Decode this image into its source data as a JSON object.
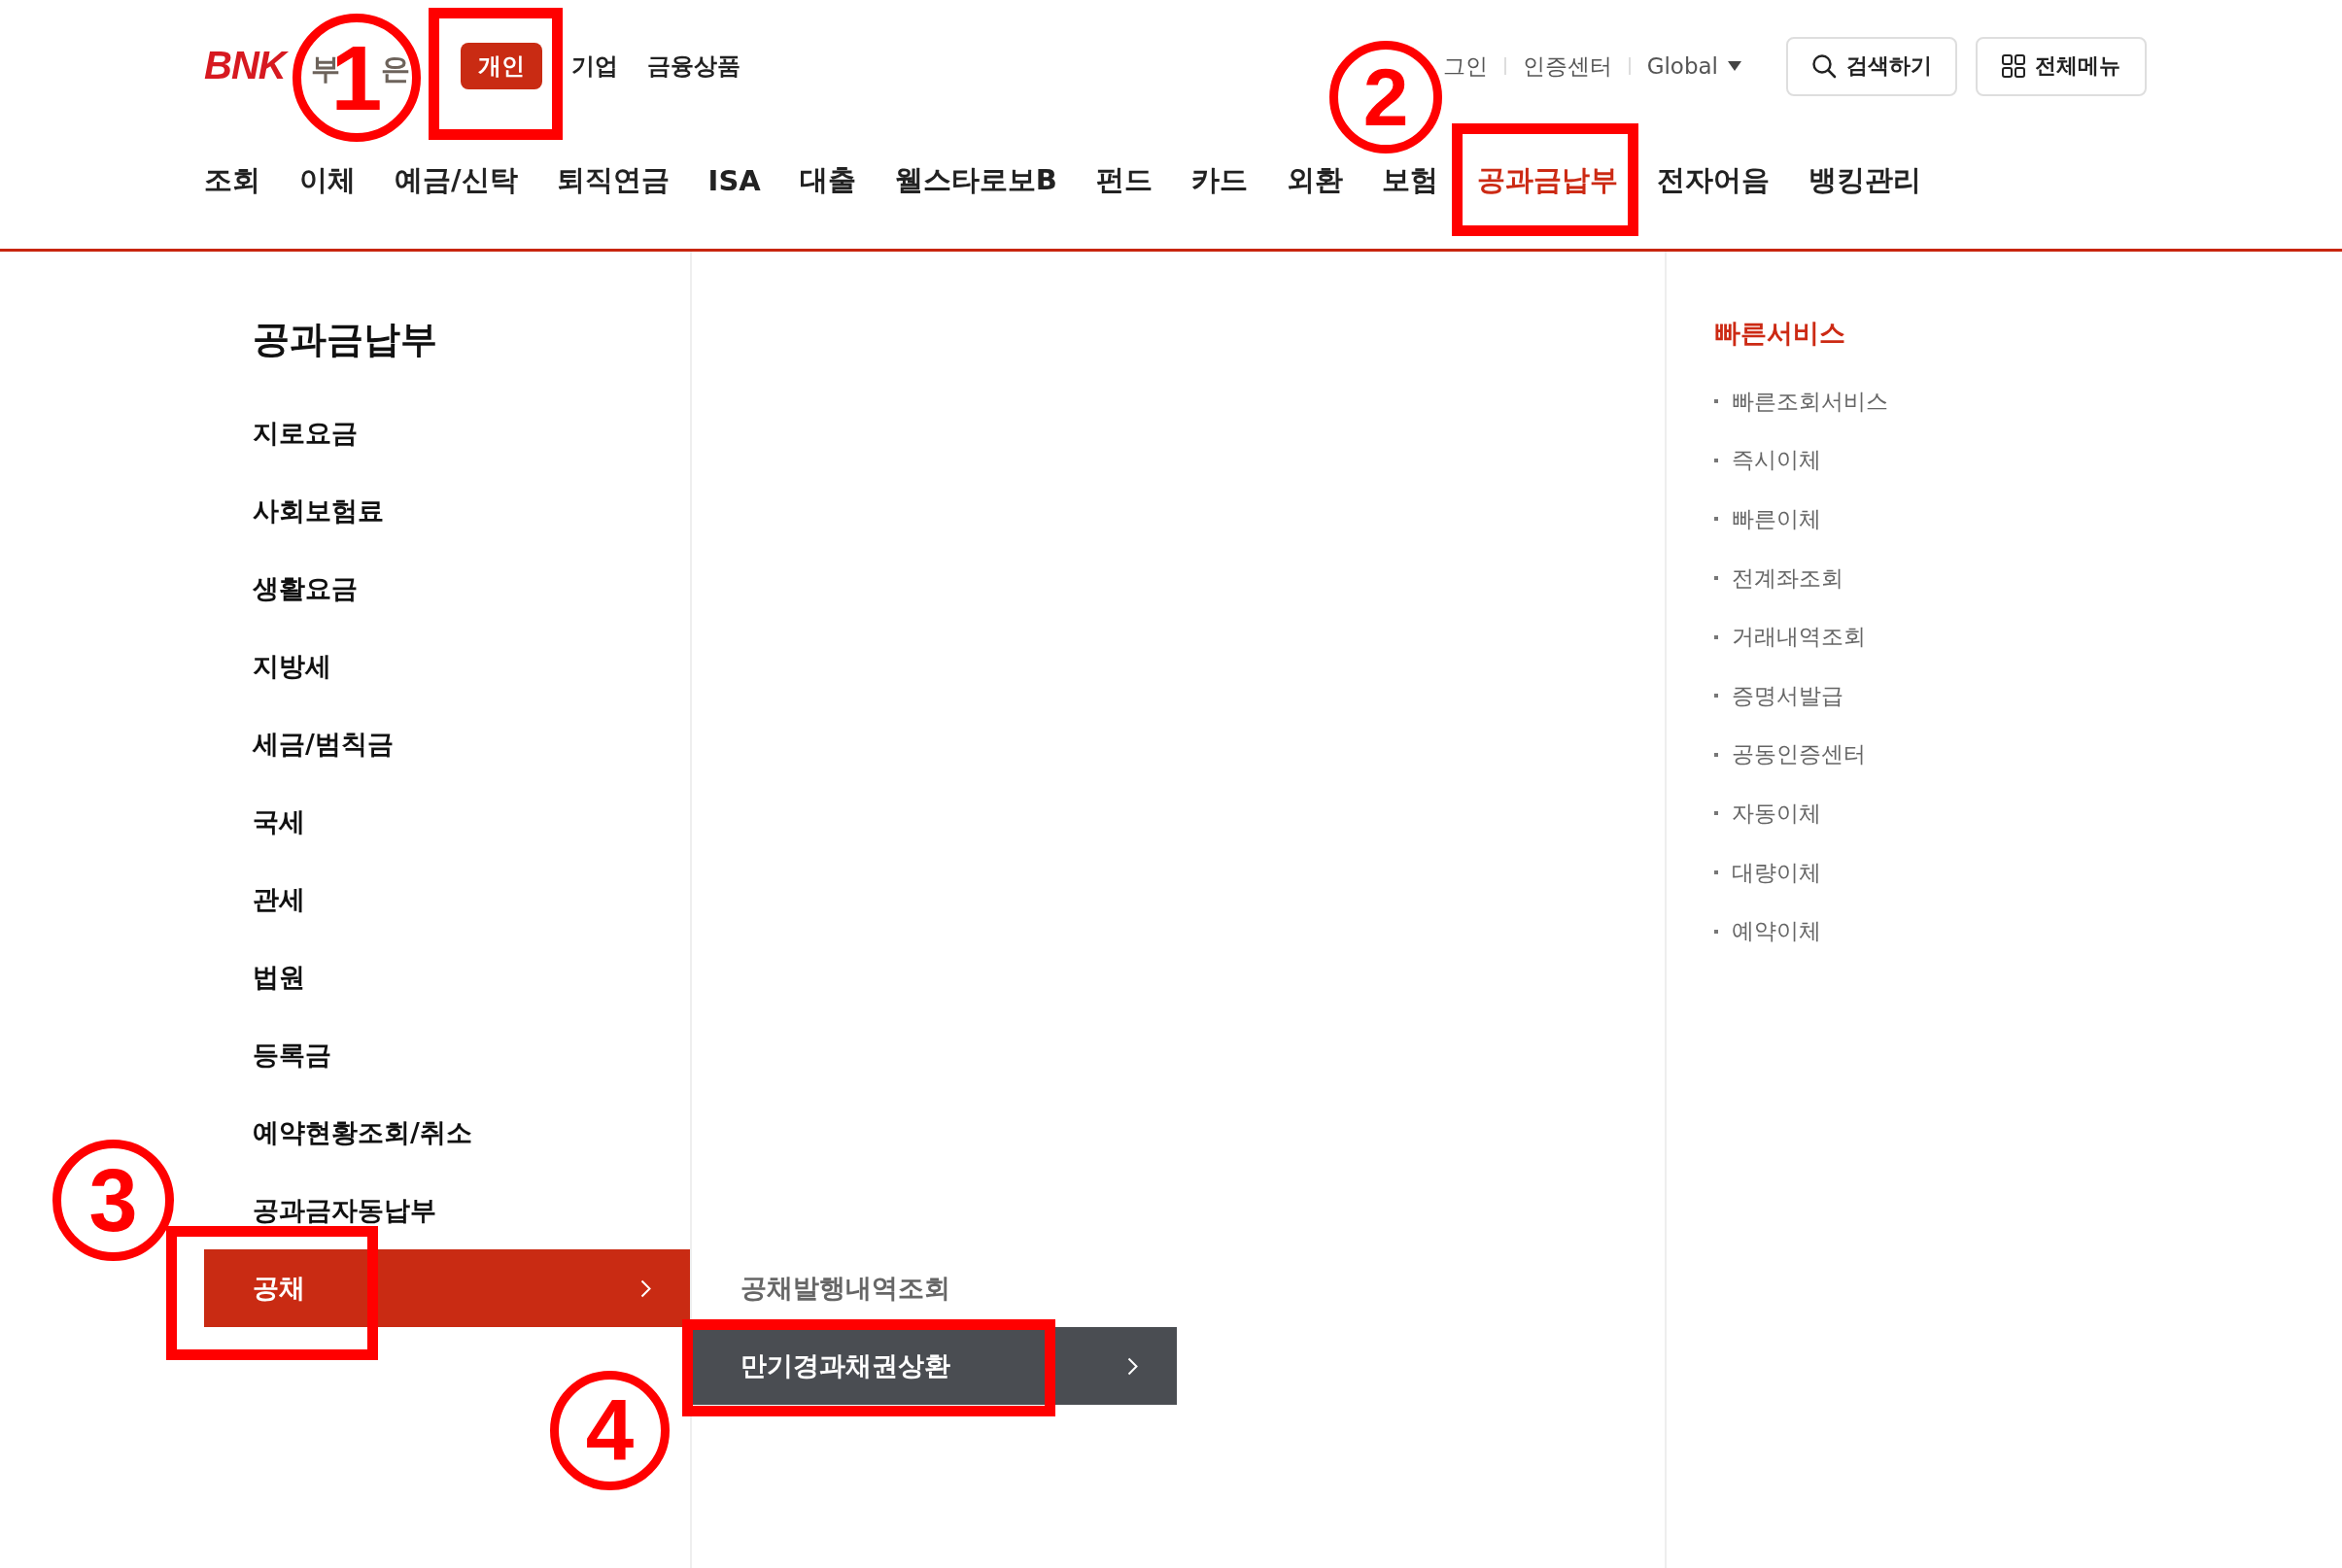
{
  "header": {
    "logo": {
      "mark": "BNK",
      "name_fragments": [
        "부",
        "은"
      ]
    },
    "segments": [
      {
        "label": "개인",
        "selected": true
      },
      {
        "label": "기업",
        "selected": false
      },
      {
        "label": "금융상품",
        "selected": false
      }
    ],
    "utility_links": [
      {
        "kind": "link",
        "label": "그인"
      },
      {
        "kind": "link",
        "label": "인증센터"
      },
      {
        "kind": "dropdown",
        "label": "Global"
      }
    ],
    "buttons": [
      {
        "kind": "search",
        "label": "검색하기"
      },
      {
        "kind": "menu",
        "label": "전체메뉴"
      }
    ]
  },
  "nav": [
    {
      "label": "조회",
      "selected": false
    },
    {
      "label": "이체",
      "selected": false
    },
    {
      "label": "예금/신탁",
      "selected": false
    },
    {
      "label": "퇴직연금",
      "selected": false
    },
    {
      "label": "ISA",
      "selected": false
    },
    {
      "label": "대출",
      "selected": false
    },
    {
      "label": "웰스타로보B",
      "selected": false
    },
    {
      "label": "펀드",
      "selected": false
    },
    {
      "label": "카드",
      "selected": false
    },
    {
      "label": "외환",
      "selected": false
    },
    {
      "label": "보험",
      "selected": false
    },
    {
      "label": "공과금납부",
      "selected": true
    },
    {
      "label": "전자어음",
      "selected": false
    },
    {
      "label": "뱅킹관리",
      "selected": false
    }
  ],
  "submenu": {
    "title": "공과금납부",
    "items": [
      {
        "label": "지로요금",
        "selected": false
      },
      {
        "label": "사회보험료",
        "selected": false
      },
      {
        "label": "생활요금",
        "selected": false
      },
      {
        "label": "지방세",
        "selected": false
      },
      {
        "label": "세금/범칙금",
        "selected": false
      },
      {
        "label": "국세",
        "selected": false
      },
      {
        "label": "관세",
        "selected": false
      },
      {
        "label": "법원",
        "selected": false
      },
      {
        "label": "등록금",
        "selected": false
      },
      {
        "label": "예약현황조회/취소",
        "selected": false
      },
      {
        "label": "공과금자동납부",
        "selected": false
      },
      {
        "label": "공채",
        "selected": true,
        "children": [
          {
            "label": "공채발행내역조회",
            "selected": false
          },
          {
            "label": "만기경과채권상환",
            "selected": true
          }
        ]
      }
    ]
  },
  "quick_services": {
    "title": "빠른서비스",
    "items": [
      "빠른조회서비스",
      "즉시이체",
      "빠른이체",
      "전계좌조회",
      "거래내역조회",
      "증명서발급",
      "공동인증센터",
      "자동이체",
      "대량이체",
      "예약이체"
    ]
  },
  "annotations": [
    {
      "number": "1"
    },
    {
      "number": "2"
    },
    {
      "number": "3"
    },
    {
      "number": "4"
    }
  ]
}
